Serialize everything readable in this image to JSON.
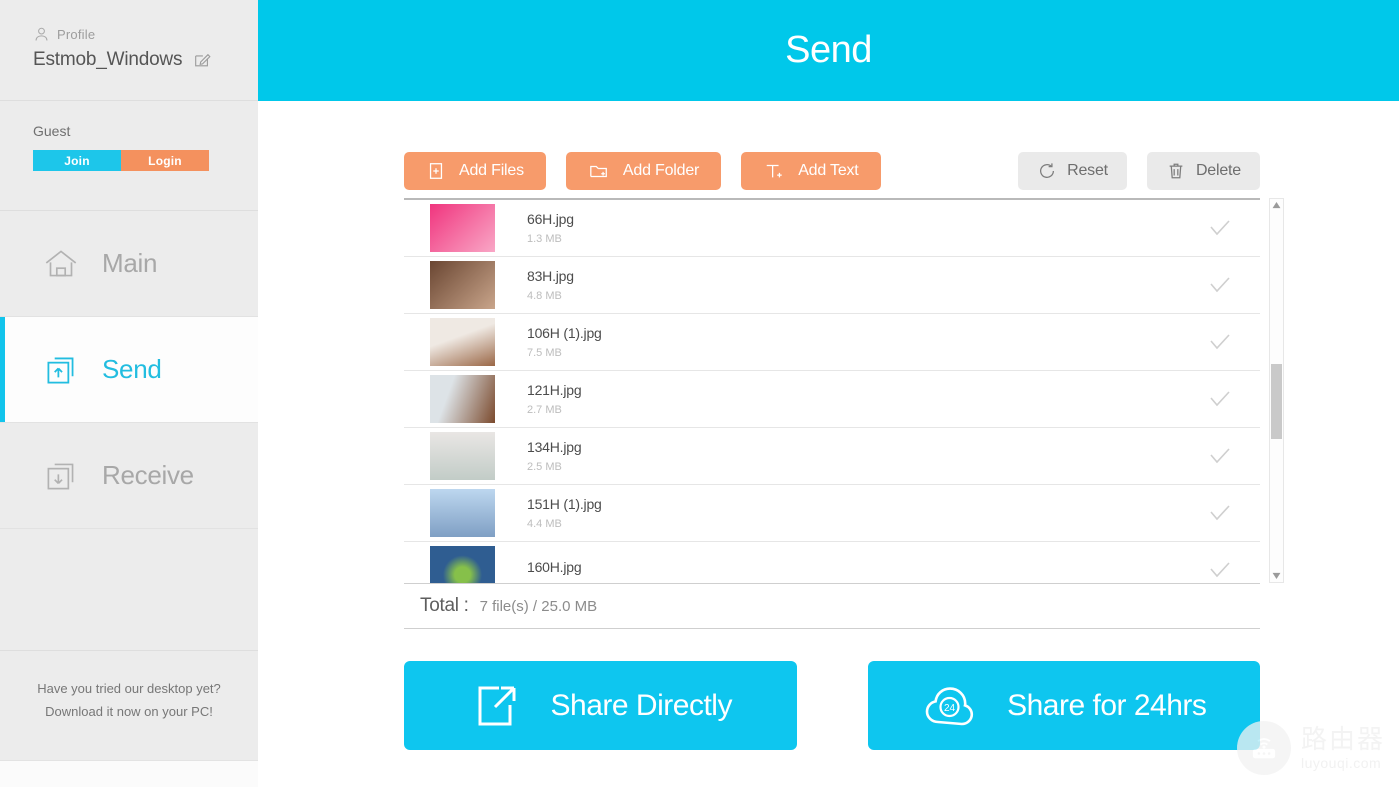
{
  "sidebar": {
    "profile": {
      "icon": "person-icon",
      "label": "Profile",
      "name": "Estmob_Windows",
      "edit_icon": "edit-pencil-icon"
    },
    "guest": {
      "label": "Guest",
      "join_label": "Join",
      "login_label": "Login",
      "join_color": "#1dc6ea",
      "login_color": "#f4915e"
    },
    "nav": [
      {
        "label": "Main",
        "icon": "home-icon",
        "active": false
      },
      {
        "label": "Send",
        "icon": "send-up-arrow-icon",
        "active": true
      },
      {
        "label": "Receive",
        "icon": "receive-down-arrow-icon",
        "active": false
      }
    ],
    "promo": {
      "line1": "Have you tried our desktop yet?",
      "line2": "Download it now on your PC!"
    }
  },
  "header": {
    "title": "Send",
    "background": "#00c8ea"
  },
  "toolbar": {
    "add_files_label": "Add Files",
    "add_folder_label": "Add Folder",
    "add_text_label": "Add Text",
    "reset_label": "Reset",
    "delete_label": "Delete",
    "orange": "#f79b6b",
    "gray": "#eaeaea"
  },
  "file_list": {
    "rows": [
      {
        "name": "66H.jpg",
        "size": "1.3 MB",
        "checked": true,
        "thumb_from": "#f0357e",
        "thumb_to": "#f9a7c6"
      },
      {
        "name": "83H.jpg",
        "size": "4.8 MB",
        "checked": true,
        "thumb_from": "#6a4632",
        "thumb_to": "#c9a58b"
      },
      {
        "name": "106H (1).jpg",
        "size": "7.5 MB",
        "checked": true,
        "thumb_from": "#efe9e3",
        "thumb_to": "#9a6746"
      },
      {
        "name": "121H.jpg",
        "size": "2.7 MB",
        "checked": true,
        "thumb_from": "#dde3e7",
        "thumb_to": "#7b4a2d"
      },
      {
        "name": "134H.jpg",
        "size": "2.5 MB",
        "checked": true,
        "thumb_from": "#e9e6e4",
        "thumb_to": "#c2ccc7"
      },
      {
        "name": "151H (1).jpg",
        "size": "4.4 MB",
        "checked": true,
        "thumb_from": "#bdd7ef",
        "thumb_to": "#7f9fc4"
      },
      {
        "name": "160H.jpg",
        "size": "",
        "checked": true,
        "thumb_from": "#2f5d91",
        "thumb_to": "#86c04a"
      }
    ],
    "total_label": "Total :",
    "total_value": "7 file(s) / 25.0 MB"
  },
  "share": {
    "direct_label": "Share Directly",
    "direct_icon": "external-link-icon",
    "timed_label": "Share for 24hrs",
    "timed_icon": "cloud-24-icon",
    "color": "#0ec6ef"
  },
  "watermark": {
    "icon": "router-icon",
    "cn": "路由器",
    "en": "luyouqi.com"
  }
}
